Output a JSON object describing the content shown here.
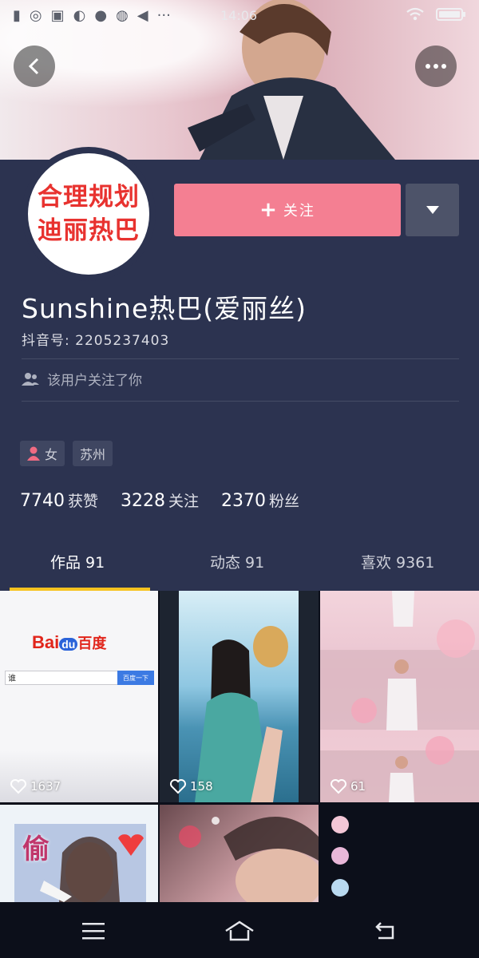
{
  "status_bar": {
    "time": "14:06"
  },
  "profile": {
    "avatar_lines": [
      "合理规划",
      "迪丽热巴"
    ],
    "follow_button": "关注",
    "nickname": "Sunshine热巴(爱丽丝)",
    "douyin_id": "抖音号: 2205237403",
    "follow_note": "该用户关注了你",
    "tags": [
      "女",
      "苏州"
    ],
    "stats": [
      {
        "value": "7740",
        "label": "获赞"
      },
      {
        "value": "3228",
        "label": "关注"
      },
      {
        "value": "2370",
        "label": "粉丝"
      }
    ]
  },
  "tabs": [
    {
      "label": "作品 91",
      "active": true
    },
    {
      "label": "动态 91",
      "active": false
    },
    {
      "label": "喜欢 9361",
      "active": false
    }
  ],
  "videos": [
    {
      "likes": "1637",
      "logo_text": "Bai",
      "logo_text2": "百度",
      "logo_du": "du",
      "search_text": "谁",
      "search_btn": "百度一下"
    },
    {
      "likes": "158"
    },
    {
      "likes": "61"
    },
    {
      "overlay_text": "偷"
    },
    {}
  ],
  "colors": {
    "panel": "#2c3350",
    "follow": "#f47f92",
    "tab_indicator": "#f7c31f"
  }
}
